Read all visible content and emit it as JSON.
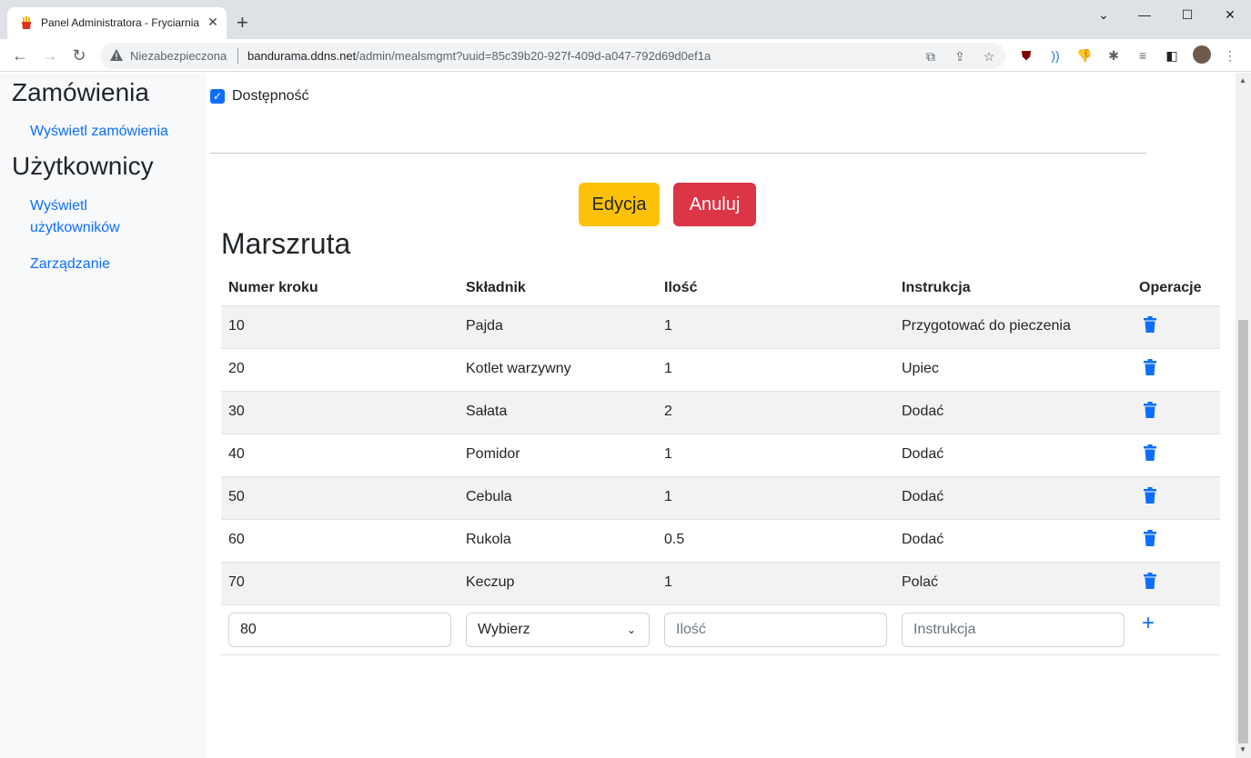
{
  "browser": {
    "tab_title": "Panel Administratora - Fryciarnia",
    "security_label": "Niezabezpieczona",
    "url_host": "bandurama.ddns.net",
    "url_path": "/admin/mealsmgmt?uuid=85c39b20-927f-409d-a047-792d69d0ef1a"
  },
  "sidebar": {
    "orders_heading": "Zamówienia",
    "orders_link": "Wyświetl zamówienia",
    "users_heading": "Użytkownicy",
    "users_link_line1": "Wyświetl",
    "users_link_line2": "użytkowników",
    "manage_link": "Zarządzanie"
  },
  "form": {
    "availability_label": "Dostępność",
    "availability_checked": true,
    "edit_button": "Edycja",
    "cancel_button": "Anuluj"
  },
  "route": {
    "title": "Marszruta",
    "columns": [
      "Numer kroku",
      "Składnik",
      "Ilość",
      "Instrukcja",
      "Operacje"
    ],
    "rows": [
      {
        "step": "10",
        "ingredient": "Pajda",
        "qty": "1",
        "instruction": "Przygotować do pieczenia"
      },
      {
        "step": "20",
        "ingredient": "Kotlet warzywny",
        "qty": "1",
        "instruction": "Upiec"
      },
      {
        "step": "30",
        "ingredient": "Sałata",
        "qty": "2",
        "instruction": "Dodać"
      },
      {
        "step": "40",
        "ingredient": "Pomidor",
        "qty": "1",
        "instruction": "Dodać"
      },
      {
        "step": "50",
        "ingredient": "Cebula",
        "qty": "1",
        "instruction": "Dodać"
      },
      {
        "step": "60",
        "ingredient": "Rukola",
        "qty": "0.5",
        "instruction": "Dodać"
      },
      {
        "step": "70",
        "ingredient": "Keczup",
        "qty": "1",
        "instruction": "Polać"
      }
    ],
    "new_row": {
      "step_value": "80",
      "ingredient_selected": "Wybierz",
      "qty_placeholder": "Ilość",
      "instruction_placeholder": "Instrukcja"
    }
  },
  "colors": {
    "primary": "#0d6efd",
    "warning": "#ffc107",
    "danger": "#dc3545"
  }
}
